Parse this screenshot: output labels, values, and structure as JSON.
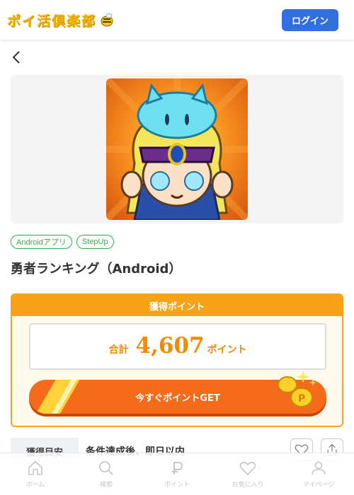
{
  "header": {
    "logo_text": "ポイ活倶楽部",
    "login_label": "ログイン"
  },
  "tags": [
    "Androidアプリ",
    "StepUp"
  ],
  "title": "勇者ランキング（Android）",
  "points": {
    "header": "獲得ポイント",
    "total_label": "合計",
    "total_value": "4,607",
    "total_unit": "ポイント",
    "cta_label": "今すぐポイントGET"
  },
  "info": {
    "label": "獲得目安",
    "value": "条件達成後、即日以内"
  },
  "bottom_nav": [
    {
      "label": "ホーム",
      "icon": "home-icon"
    },
    {
      "label": "検索",
      "icon": "search-icon"
    },
    {
      "label": "ポイント",
      "icon": "point-icon"
    },
    {
      "label": "お気に入り",
      "icon": "heart-icon"
    },
    {
      "label": "マイページ",
      "icon": "user-icon"
    }
  ],
  "colors": {
    "accent_blue": "#2f6fe0",
    "orange": "#f8a21a",
    "cta": "#f46b1c",
    "tag_green": "#2bb24c"
  }
}
